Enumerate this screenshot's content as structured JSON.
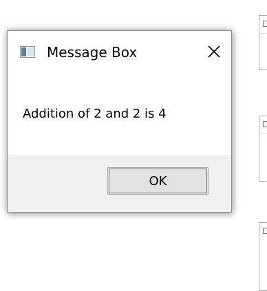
{
  "dialog": {
    "title": "Message Box",
    "icon": "app-window-icon",
    "close_icon": "close-icon",
    "message": "Addition of 2 and 2 is 4",
    "ok_label": "OK"
  },
  "colors": {
    "button_area_bg": "#f0f0f0",
    "button_bg": "#e1e1e1",
    "border": "#8a8a8a",
    "icon_accent": "#5a7f9a"
  }
}
